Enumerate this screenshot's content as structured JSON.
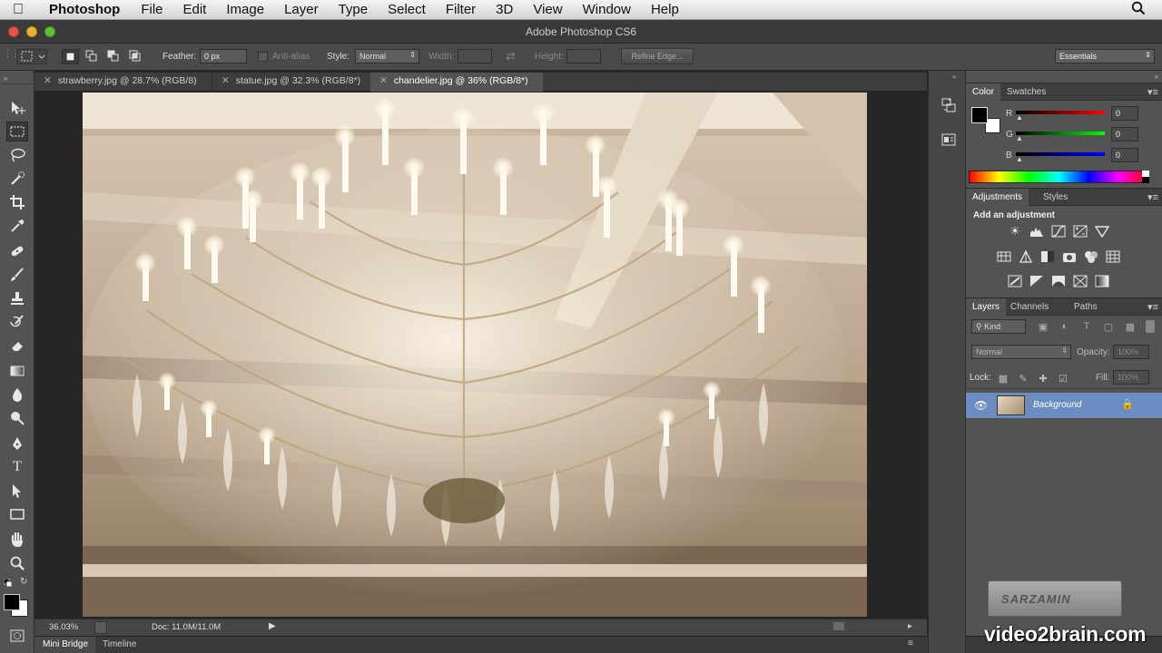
{
  "menubar": {
    "app": "Photoshop",
    "items": [
      "File",
      "Edit",
      "Image",
      "Layer",
      "Type",
      "Select",
      "Filter",
      "3D",
      "View",
      "Window",
      "Help"
    ]
  },
  "window": {
    "title": "Adobe Photoshop CS6"
  },
  "options": {
    "feather_label": "Feather:",
    "feather_value": "0 px",
    "antialias_label": "Anti-alias",
    "style_label": "Style:",
    "style_value": "Normal",
    "width_label": "Width:",
    "height_label": "Height:",
    "refine_edge": "Refine Edge...",
    "workspace": "Essentials"
  },
  "tabs": [
    {
      "label": "strawberry.jpg @ 28.7% (RGB/8)",
      "active": false
    },
    {
      "label": "statue.jpg @ 32.3% (RGB/8*)",
      "active": false
    },
    {
      "label": "chandelier.jpg @ 36% (RGB/8*)",
      "active": true
    }
  ],
  "status": {
    "zoom": "36.03%",
    "doc": "Doc: 11.0M/11.0M"
  },
  "bottom_tabs": [
    "Mini Bridge",
    "Timeline"
  ],
  "color_panel": {
    "tabs": [
      "Color",
      "Swatches"
    ],
    "channels": [
      {
        "name": "R",
        "value": "0"
      },
      {
        "name": "G",
        "value": "0"
      },
      {
        "name": "B",
        "value": "0"
      }
    ]
  },
  "adjustments_panel": {
    "tabs": [
      "Adjustments",
      "Styles"
    ],
    "heading": "Add an adjustment"
  },
  "layers_panel": {
    "tabs": [
      "Layers",
      "Channels",
      "Paths"
    ],
    "filter_kind": "Kind",
    "blend_mode": "Normal",
    "opacity_label": "Opacity:",
    "opacity_value": "100%",
    "lock_label": "Lock:",
    "fill_label": "Fill:",
    "fill_value": "100%",
    "layers": [
      {
        "name": "Background",
        "visible": true,
        "locked": true
      }
    ]
  },
  "watermark": {
    "main": "video2brain.com",
    "badge": "SARZAMIN"
  },
  "colors": {
    "accent": "#6b8cc0",
    "panel_bg": "#535353",
    "app_bg": "#262626"
  }
}
